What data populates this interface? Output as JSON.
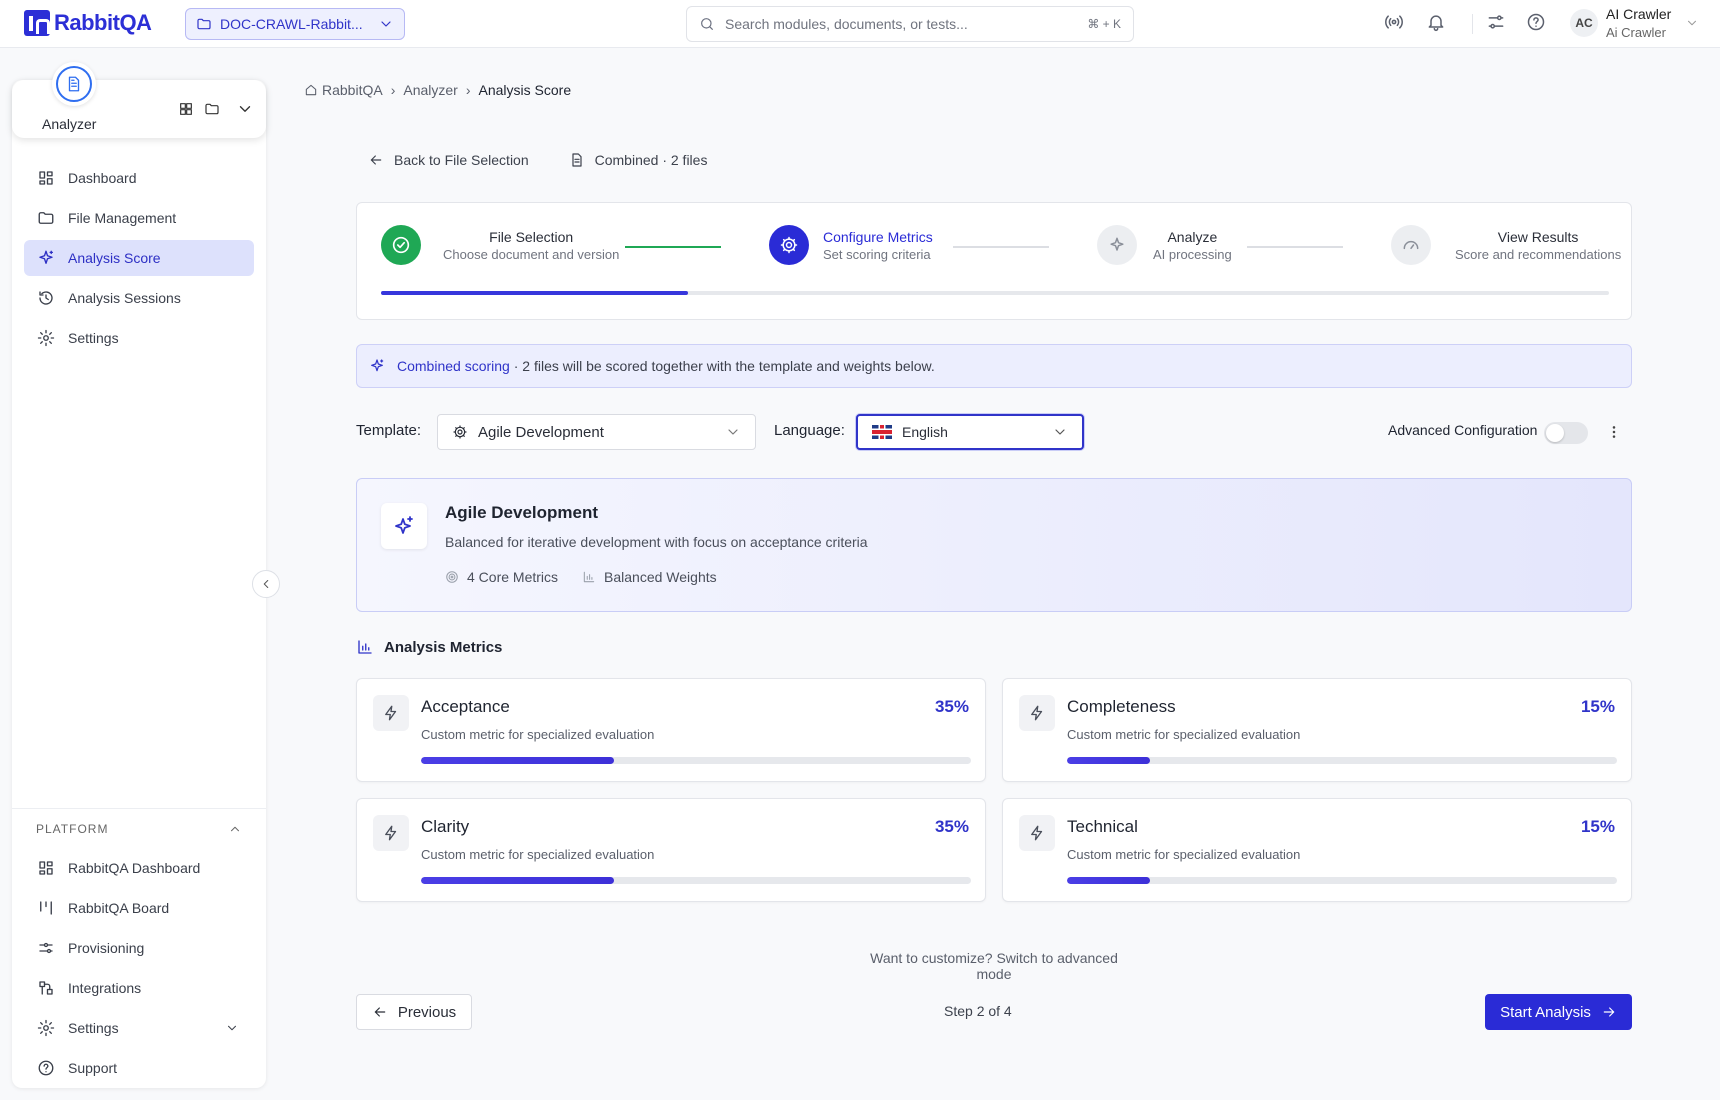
{
  "app": {
    "logo_text": "RabbitQA",
    "brand_color": "#2c2fd6"
  },
  "topbar": {
    "project": "DOC-CRAWL-Rabbit...",
    "search_placeholder": "Search modules, documents, or tests...",
    "search_shortcut": "⌘ + K",
    "user_initials": "AC",
    "user_name": "AI Crawler",
    "user_sub": "Ai Crawler"
  },
  "sidebar": {
    "module": "Analyzer",
    "items": [
      {
        "label": "Dashboard",
        "icon": "dashboard-icon"
      },
      {
        "label": "File Management",
        "icon": "folder-icon"
      },
      {
        "label": "Analysis Score",
        "icon": "sparkle-icon",
        "active": true
      },
      {
        "label": "Analysis Sessions",
        "icon": "history-icon"
      },
      {
        "label": "Settings",
        "icon": "gear-icon"
      }
    ],
    "platform_title": "PLATFORM",
    "platform_items": [
      {
        "label": "RabbitQA Dashboard",
        "icon": "dashboard-icon"
      },
      {
        "label": "RabbitQA Board",
        "icon": "board-icon"
      },
      {
        "label": "Provisioning",
        "icon": "sliders-icon"
      },
      {
        "label": "Integrations",
        "icon": "integrations-icon"
      },
      {
        "label": "Settings",
        "icon": "gear-icon"
      },
      {
        "label": "Support",
        "icon": "help-icon"
      }
    ]
  },
  "breadcrumb": {
    "home": "RabbitQA",
    "parent": "Analyzer",
    "current": "Analysis Score"
  },
  "back": {
    "label": "Back to File Selection",
    "combined": "Combined · 2 files"
  },
  "stepper": {
    "steps": [
      {
        "title": "File Selection",
        "sub": "Choose document and version",
        "state": "done"
      },
      {
        "title": "Configure Metrics",
        "sub": "Set scoring criteria",
        "state": "active"
      },
      {
        "title": "Analyze",
        "sub": "AI processing",
        "state": "pending"
      },
      {
        "title": "View Results",
        "sub": "Score and recommendations",
        "state": "pending"
      }
    ],
    "progress": 0.25
  },
  "banner": {
    "highlight": "Combined scoring",
    "text": " · 2 files will be scored together with the template and weights below."
  },
  "controls": {
    "template_label": "Template:",
    "template_value": "Agile Development",
    "language_label": "Language:",
    "language_value": "English",
    "advanced_label": "Advanced Configuration",
    "advanced_on": false
  },
  "template_card": {
    "title": "Agile Development",
    "desc": "Balanced for iterative development with focus on acceptance criteria",
    "tag1": "4 Core Metrics",
    "tag2": "Balanced Weights"
  },
  "metrics_title": "Analysis Metrics",
  "metrics": [
    {
      "name": "Acceptance",
      "desc": "Custom metric for specialized evaluation",
      "pct": "35%",
      "value": 35
    },
    {
      "name": "Completeness",
      "desc": "Custom metric for specialized evaluation",
      "pct": "15%",
      "value": 15
    },
    {
      "name": "Clarity",
      "desc": "Custom metric for specialized evaluation",
      "pct": "35%",
      "value": 35
    },
    {
      "name": "Technical",
      "desc": "Custom metric for specialized evaluation",
      "pct": "15%",
      "value": 15
    }
  ],
  "footer": {
    "customize": "Want to customize? Switch to advanced mode",
    "previous": "Previous",
    "step_count": "Step 2 of 4",
    "start": "Start Analysis"
  }
}
